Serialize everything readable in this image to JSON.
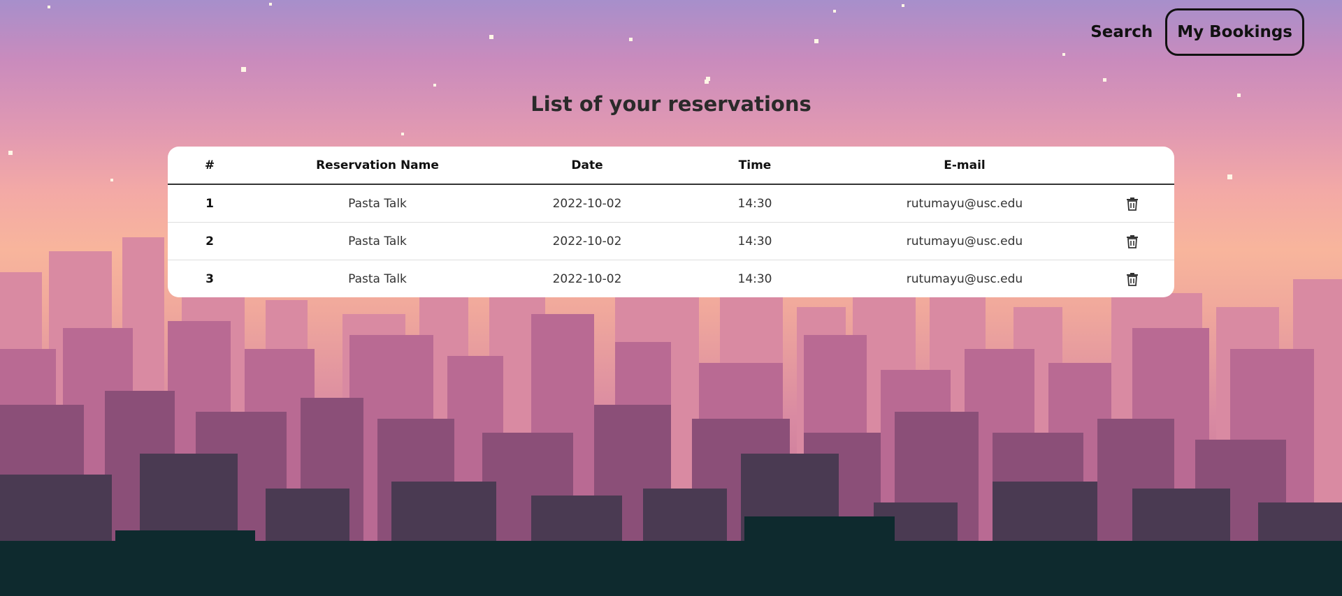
{
  "nav": {
    "search_label": "Search",
    "bookings_label": "My Bookings"
  },
  "page": {
    "title": "List of your reservations"
  },
  "table": {
    "headers": [
      "#",
      "Reservation Name",
      "Date",
      "Time",
      "E-mail",
      ""
    ],
    "rows": [
      {
        "num": "1",
        "name": "Pasta Talk",
        "date": "2022-10-02",
        "time": "14:30",
        "email": "rutumayu@usc.edu",
        "action_icon": "trash-icon"
      },
      {
        "num": "2",
        "name": "Pasta Talk",
        "date": "2022-10-02",
        "time": "14:30",
        "email": "rutumayu@usc.edu",
        "action_icon": "trash-icon"
      },
      {
        "num": "3",
        "name": "Pasta Talk",
        "date": "2022-10-02",
        "time": "14:30",
        "email": "rutumayu@usc.edu",
        "action_icon": "trash-icon"
      }
    ]
  },
  "colors": {
    "sky_top": "#a78fcb",
    "sky_mid": "#f8b59c",
    "building_far": "#d98aa2",
    "building_mid": "#a8567e",
    "building_near": "#4a3a52",
    "foreground": "#0e2a2e"
  }
}
